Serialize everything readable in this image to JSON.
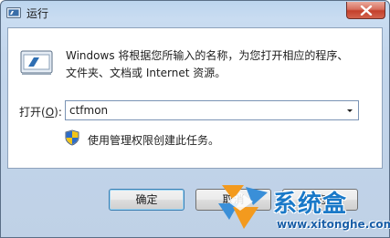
{
  "window": {
    "title": "运行",
    "close_icon": "close-icon"
  },
  "dialog": {
    "description": "Windows 将根据您所输入的名称，为您打开相应的程序、文件夹、文档或 Internet 资源。",
    "description_line1": "Windows 将根据您所输入的名称，为您打开相应的程序、",
    "description_line2": "文件夹、文档或 Internet 资源。",
    "open_label_prefix": "打开(",
    "open_label_key": "O",
    "open_label_suffix": "):",
    "input_value": "ctfmon",
    "admin_note": "使用管理权限创建此任务。"
  },
  "buttons": {
    "ok": "确定",
    "cancel": "取消",
    "browse": "浏览..."
  },
  "watermark": {
    "brand": "系统盒",
    "url": "www.xitonghe.com"
  },
  "colors": {
    "title_bar": "#c9dcf1",
    "close_button": "#c4402c",
    "content_bg": "#ffffff",
    "brand_blue": "#1a79c8",
    "brand_orange": "#f39a1e"
  }
}
